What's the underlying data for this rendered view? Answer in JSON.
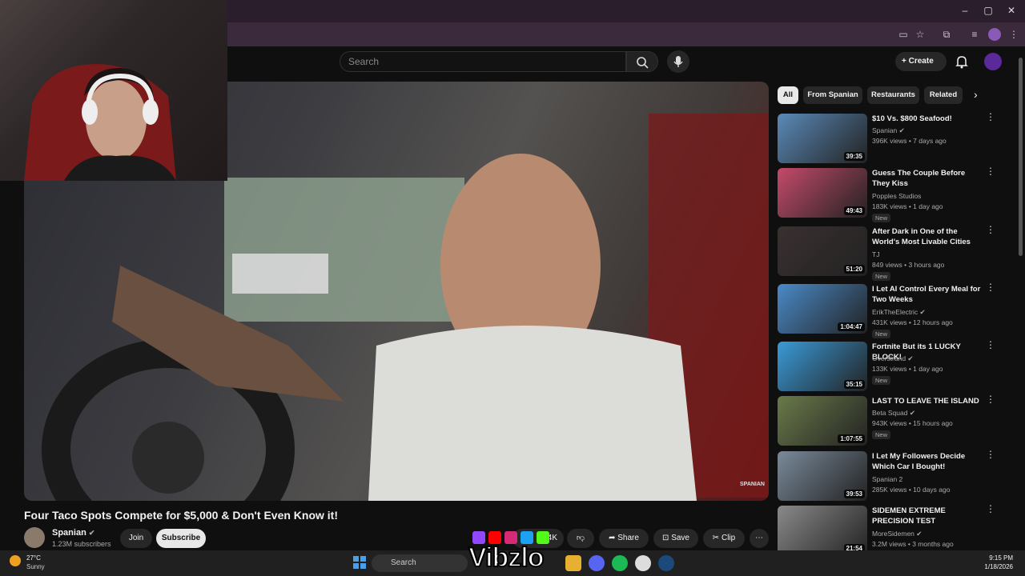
{
  "search": {
    "placeholder": "Search"
  },
  "masthead": {
    "create_label": "Create"
  },
  "video": {
    "title": "Four Taco Spots Compete for $5,000 & Don't Even Know it!",
    "channel": "Spanian",
    "subscribers": "1.23M subscribers",
    "join_label": "Join",
    "subscribe_label": "Subscribe",
    "like_count": "4K",
    "share_label": "Share",
    "save_label": "Save",
    "clip_label": "Clip",
    "watermark": "SPANIAN"
  },
  "chips": [
    "All",
    "From Spanian",
    "Restaurants",
    "Related"
  ],
  "recommendations": [
    {
      "title": "$10 Vs. $800 Seafood!",
      "channel": "Spanian",
      "verified": true,
      "meta": "396K views • 7 days ago",
      "duration": "39:35",
      "new": false,
      "color": "#5a8ab8"
    },
    {
      "title": "Guess The Couple Before They Kiss",
      "channel": "Popples Studios",
      "verified": false,
      "meta": "183K views • 1 day ago",
      "duration": "49:43",
      "new": true,
      "color": "#c44a6a"
    },
    {
      "title": "After Dark in One of the World's Most Livable Cities",
      "channel": "TJ",
      "verified": false,
      "meta": "849 views • 3 hours ago",
      "duration": "51:20",
      "new": true,
      "color": "#3a3030"
    },
    {
      "title": "I Let AI Control Every Meal for Two Weeks",
      "channel": "ErikTheElectric",
      "verified": true,
      "meta": "431K views • 12 hours ago",
      "duration": "1:04:47",
      "new": true,
      "color": "#4a8ac8"
    },
    {
      "title": "Fortnite But its 1 LUCKY BLOCK!",
      "channel": "Overstrand",
      "verified": true,
      "meta": "133K views • 1 day ago",
      "duration": "35:15",
      "new": true,
      "color": "#3a9ad8"
    },
    {
      "title": "LAST TO LEAVE THE ISLAND",
      "channel": "Beta Squad",
      "verified": true,
      "meta": "943K views • 15 hours ago",
      "duration": "1:07:55",
      "new": true,
      "color": "#6a7a4a"
    },
    {
      "title": "I Let My Followers Decide Which Car I Bought!",
      "channel": "Spanian 2",
      "verified": false,
      "meta": "285K views • 10 days ago",
      "duration": "39:53",
      "new": false,
      "color": "#7a8a9a"
    },
    {
      "title": "SIDEMEN EXTREME PRECISION TEST",
      "channel": "MoreSidemen",
      "verified": true,
      "meta": "3.2M views • 3 months ago",
      "duration": "21:54",
      "new": false,
      "color": "#8a8a8a"
    }
  ],
  "new_label": "New",
  "taskbar": {
    "weather_temp": "27°C",
    "weather_desc": "Sunny",
    "search_label": "Search",
    "time": "9:15 PM",
    "date": "1/18/2026"
  },
  "overlay": {
    "brand": "Vibzlo"
  }
}
